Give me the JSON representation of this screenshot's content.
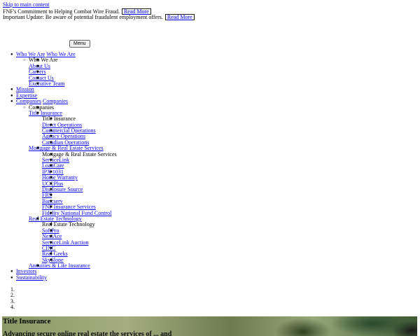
{
  "skip_link": "Skip to main content",
  "alerts": [
    {
      "text": "FNF's Commitment to Helping Combat Wire Fraud.",
      "button": "Read More"
    },
    {
      "text": "Important Update: Be aware of potential fraudulent employment offers.",
      "button": "Read More"
    }
  ],
  "menu_button": "Menu",
  "nav": {
    "who_we_are": {
      "link": "Who We Are",
      "toggle": "Who We Are",
      "heading": "Who We Are",
      "items": [
        "About Us",
        "Careers",
        "Contact Us",
        "Executive Team"
      ]
    },
    "mission": "Mission",
    "expertise": "Expertise",
    "companies": {
      "link": "Companies",
      "toggle": "Companies",
      "heading": "Companies",
      "title_insurance": {
        "link": "Title Insurance",
        "heading": "Title Insurance",
        "items": [
          "Direct Operations",
          "Commercial Operations",
          "Agency Operations",
          "Canadian Operations"
        ]
      },
      "mortgage": {
        "link": "Mortgage & Real Estate Services",
        "heading": "Mortgage & Real Estate Services",
        "items": [
          "ServiceLink",
          "LoanCare",
          "IPX 1031",
          "Home Warranty",
          "UCCPlus",
          "Disclosure Source",
          "FRS",
          "Bancserv",
          "FNF Insurance Services",
          "Fidelity National Fund Control"
        ]
      },
      "real_estate_tech": {
        "link": "Real Estate Technology",
        "heading": "Real Estate Technology",
        "items": [
          "SoftPro",
          "NextAce",
          "ServiceLink Auction",
          "CINC",
          "Real Geeks",
          "SkySlope"
        ]
      },
      "annuities": "Annuities & Life Insurance"
    },
    "investors": "Investors",
    "sustainability": "Sustainability"
  },
  "slides": [
    "1.",
    "2.",
    "3.",
    "4."
  ],
  "hero": {
    "title": "Title Insurance",
    "subtitle": "Advancing  secure  online  real  estate  the  services  of  ...  and"
  }
}
